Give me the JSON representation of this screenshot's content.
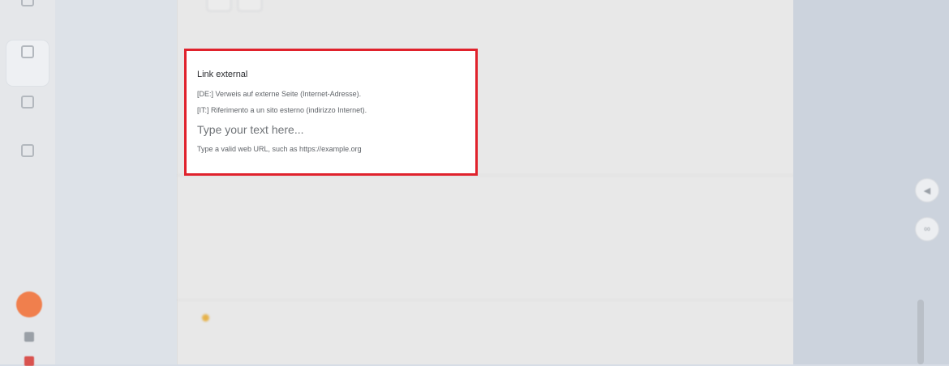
{
  "focused_field": {
    "title": "Link external",
    "desc_de": "[DE:] Verweis auf externe Seite (Internet-Adresse).",
    "desc_it": "[IT:] Riferimento a un sito esterno (indirizzo Internet).",
    "value": "",
    "placeholder": "Type your text here...",
    "hint": "Type a valid web URL, such as https://example.org"
  },
  "icons": {
    "rail": [
      "document-icon",
      "gallery-icon",
      "calendar-icon",
      "grid-icon"
    ],
    "side": [
      "collapse-icon",
      "link-icon"
    ]
  },
  "colors": {
    "highlight_border": "#e0222c",
    "accent_orange": "#f07f4d",
    "status_dot": "#e6b24a"
  }
}
